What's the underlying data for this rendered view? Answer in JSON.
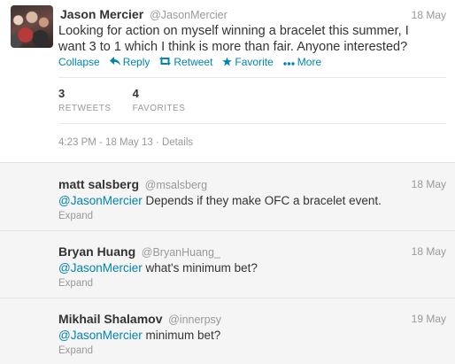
{
  "main_tweet": {
    "fullname": "Jason Mercier",
    "screen_name": "@JasonMercier",
    "date": "18 May",
    "text": "Looking for action on myself winning a bracelet this summer,  I want 3 to 1 which I think is more than fair.  Anyone interested?",
    "actions": {
      "collapse": "Collapse",
      "reply": "Reply",
      "retweet": "Retweet",
      "favorite": "Favorite",
      "more": "More"
    },
    "stats": {
      "retweets_count": "3",
      "retweets_label": "RETWEETS",
      "favorites_count": "4",
      "favorites_label": "FAVORITES"
    },
    "timestamp": "4:23 PM - 18 May 13",
    "separator": " · ",
    "details": "Details"
  },
  "replies": [
    {
      "fullname": "matt salsberg",
      "screen_name": "@msalsberg",
      "date": "18 May",
      "mention": "@JasonMercier",
      "text": " Depends if they make OFC a bracelet event.",
      "expand": "Expand"
    },
    {
      "fullname": "Bryan Huang",
      "screen_name": "@BryanHuang_",
      "date": "18 May",
      "mention": "@JasonMercier",
      "text": " what's minimum bet?",
      "expand": "Expand"
    },
    {
      "fullname": "Mikhail Shalamov",
      "screen_name": "@innerpsy",
      "date": "19 May",
      "mention": "@JasonMercier",
      "text": " minimum bet?",
      "expand": "Expand"
    }
  ],
  "icons": {
    "reply": "reply-arrow-icon",
    "retweet": "retweet-icon",
    "favorite": "star-icon",
    "more": "dots-icon"
  },
  "colors": {
    "link": "#0084b4",
    "muted": "#999999",
    "text": "#333333",
    "reply_background": "#f5f5f5"
  }
}
